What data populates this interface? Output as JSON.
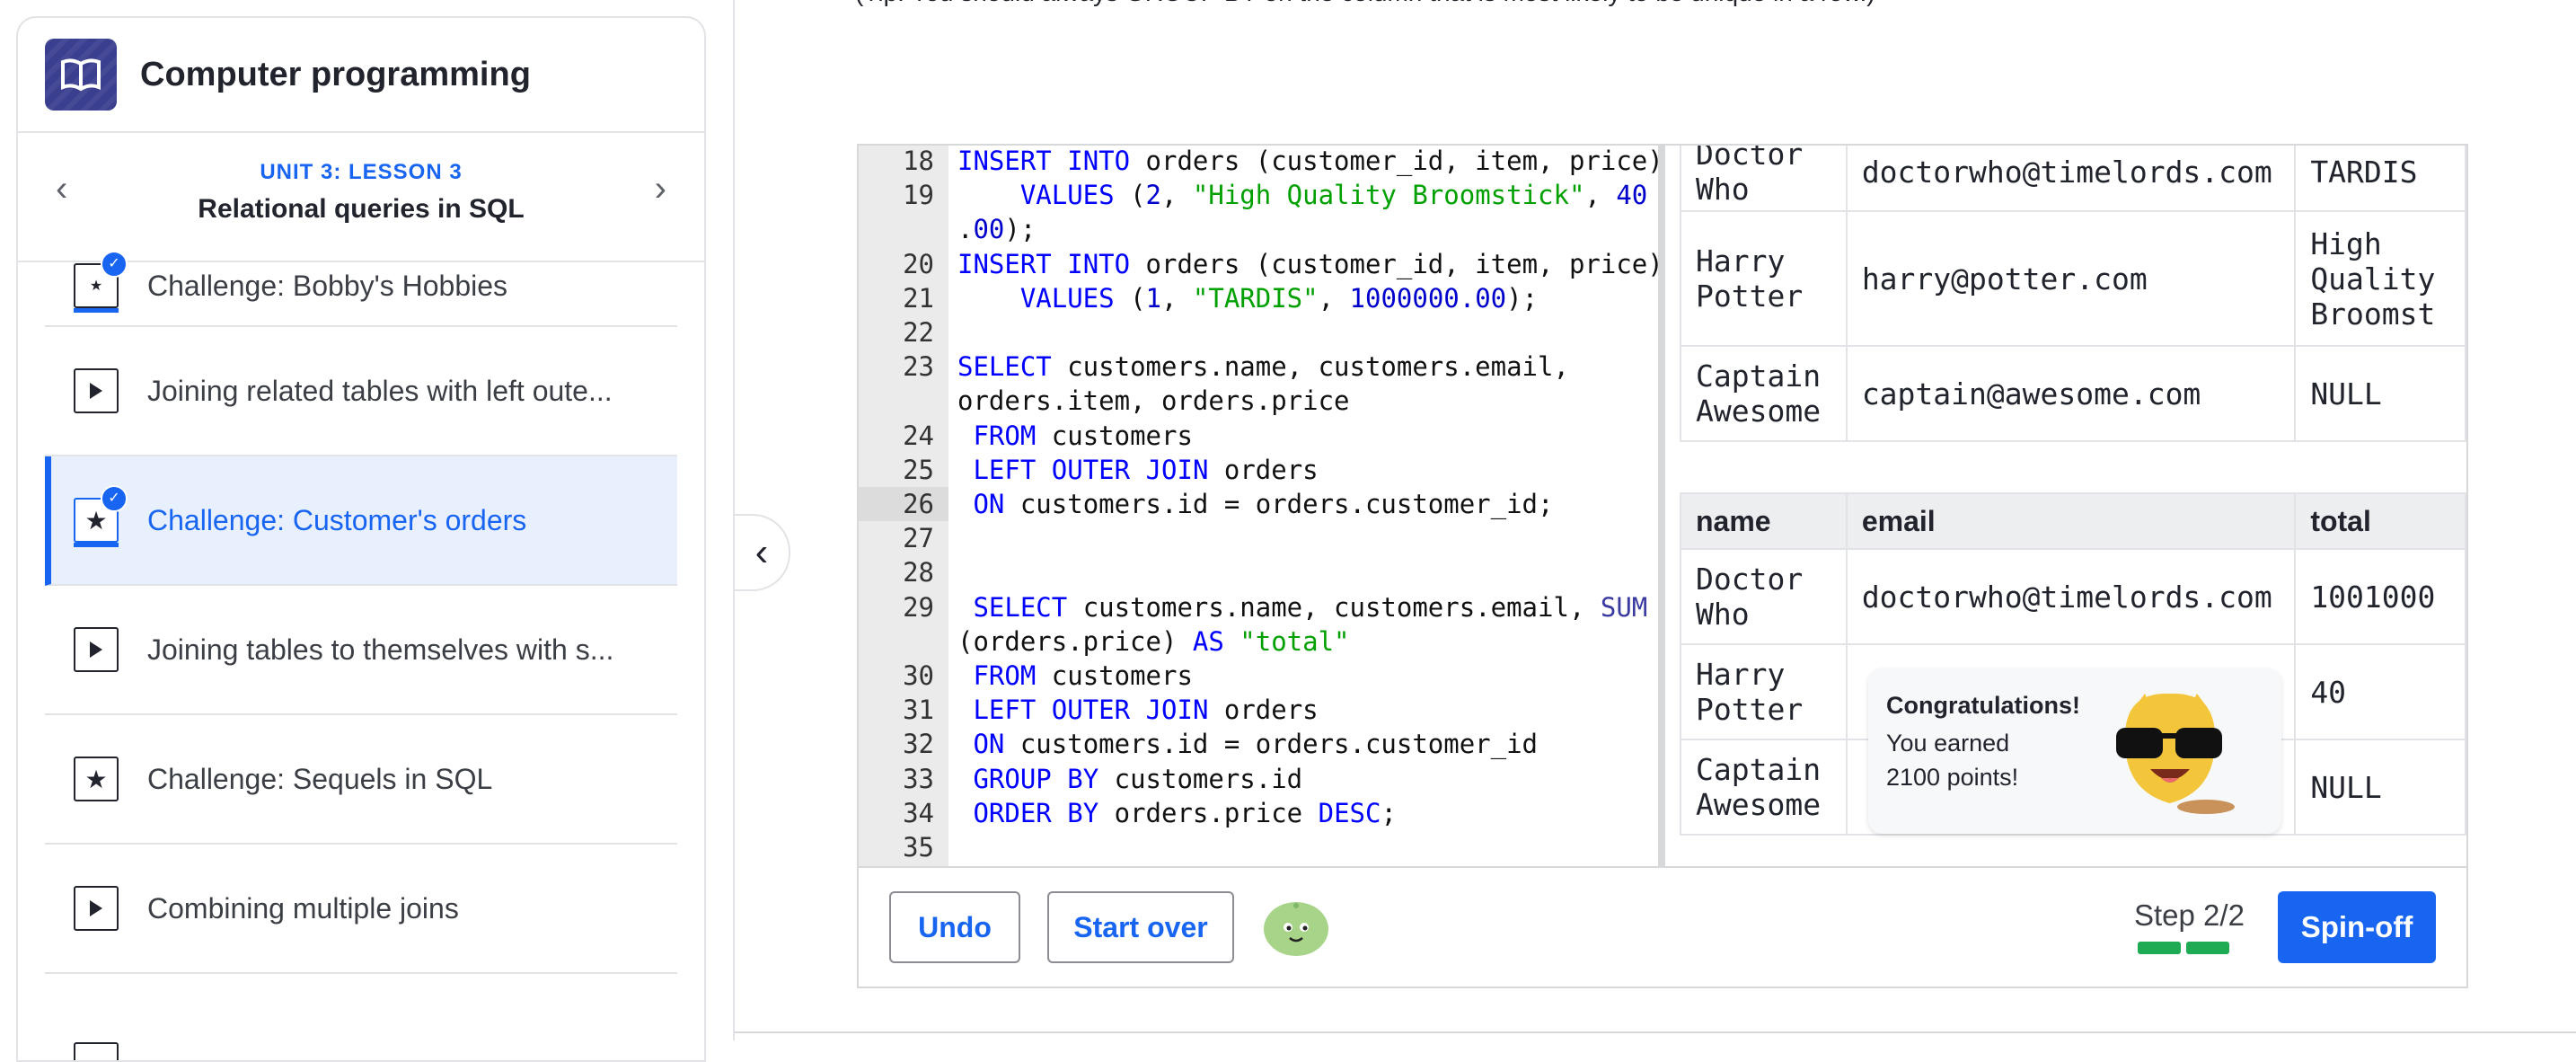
{
  "sidebar": {
    "course_title": "Computer programming",
    "unit_label": "UNIT 3: LESSON 3",
    "lesson_title": "Relational queries in SQL",
    "items": [
      {
        "label": "Challenge: Bobby's Hobbies",
        "icon": "star-icon",
        "completed": true,
        "active": false
      },
      {
        "label": "Joining related tables with left oute...",
        "icon": "play-icon",
        "completed": false,
        "active": false
      },
      {
        "label": "Challenge: Customer's orders",
        "icon": "star-icon",
        "completed": true,
        "active": true
      },
      {
        "label": "Joining tables to themselves with s...",
        "icon": "play-icon",
        "completed": false,
        "active": false
      },
      {
        "label": "Challenge: Sequels in SQL",
        "icon": "star-icon",
        "completed": false,
        "active": false
      },
      {
        "label": "Combining multiple joins",
        "icon": "play-icon",
        "completed": false,
        "active": false
      }
    ]
  },
  "tip": "(Tip: You should always GROUP BY on the column that is most likely to be unique in a row.)",
  "editor": {
    "lines": [
      {
        "n": "18",
        "code": "INSERT INTO orders (customer_id, item, price)"
      },
      {
        "n": "19",
        "code": "    VALUES (2, \"High Quality Broomstick\", 40"
      },
      {
        "n": "",
        "code": ".00);"
      },
      {
        "n": "20",
        "code": "INSERT INTO orders (customer_id, item, price)"
      },
      {
        "n": "21",
        "code": "    VALUES (1, \"TARDIS\", 1000000.00);"
      },
      {
        "n": "22",
        "code": ""
      },
      {
        "n": "23",
        "code": "SELECT customers.name, customers.email,"
      },
      {
        "n": "",
        "code": "orders.item, orders.price"
      },
      {
        "n": "24",
        "code": " FROM customers"
      },
      {
        "n": "25",
        "code": " LEFT OUTER JOIN orders"
      },
      {
        "n": "26",
        "code": " ON customers.id = orders.customer_id;"
      },
      {
        "n": "27",
        "code": ""
      },
      {
        "n": "28",
        "code": ""
      },
      {
        "n": "29",
        "code": " SELECT customers.name, customers.email, SUM"
      },
      {
        "n": "",
        "code": "(orders.price) AS \"total\""
      },
      {
        "n": "30",
        "code": " FROM customers"
      },
      {
        "n": "31",
        "code": " LEFT OUTER JOIN orders"
      },
      {
        "n": "32",
        "code": " ON customers.id = orders.customer_id"
      },
      {
        "n": "33",
        "code": " GROUP BY customers.id"
      },
      {
        "n": "34",
        "code": " ORDER BY orders.price DESC;"
      },
      {
        "n": "35",
        "code": ""
      }
    ],
    "highlighted_line": "26"
  },
  "results": {
    "table1": {
      "rows": [
        [
          "Doctor Who",
          "doctorwho@timelords.com",
          "TARDIS"
        ],
        [
          "Harry Potter",
          "harry@potter.com",
          "High Quality Broomst"
        ],
        [
          "Captain Awesome",
          "captain@awesome.com",
          "NULL"
        ]
      ]
    },
    "table2": {
      "headers": [
        "name",
        "email",
        "total"
      ],
      "rows": [
        [
          "Doctor Who",
          "doctorwho@timelords.com",
          "1001000"
        ],
        [
          "Harry Potter",
          "",
          "40"
        ],
        [
          "Captain Awesome",
          "",
          "NULL"
        ]
      ]
    }
  },
  "toast": {
    "title": "Congratulations!",
    "line1": "You earned",
    "line2": "2100 points!"
  },
  "toolbar": {
    "undo_label": "Undo",
    "start_over_label": "Start over",
    "step_label": "Step 2/2",
    "spinoff_label": "Spin-off"
  },
  "colors": {
    "accent": "#1865f2",
    "progress": "#1fab54",
    "course_icon": "#3b3f8f"
  }
}
